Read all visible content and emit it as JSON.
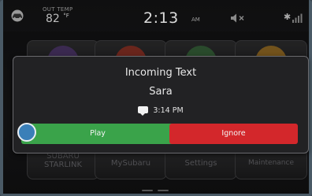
{
  "status": {
    "outside_temp_label": "OUT TEMP",
    "outside_temp_value": "82",
    "outside_temp_unit": "°F",
    "clock": "2:13",
    "ampm": "AM"
  },
  "tiles": [
    {
      "label": "",
      "color": "#5b3a86"
    },
    {
      "label": "",
      "color": "#b8321f"
    },
    {
      "label": "",
      "color": "#3a7a3e"
    },
    {
      "label": "",
      "color": "#c88a1e"
    },
    {
      "label": "SUBARU STARLINK"
    },
    {
      "label": "MySubaru"
    },
    {
      "label": "Settings"
    },
    {
      "label": "Maintenance"
    }
  ],
  "dialog": {
    "title": "Incoming Text",
    "sender": "Sara",
    "time": "3:14 PM",
    "play_label": "Play",
    "ignore_label": "Ignore"
  },
  "colors": {
    "play": "#3aa34a",
    "ignore": "#d3272b",
    "focus": "#3a7fb8"
  }
}
